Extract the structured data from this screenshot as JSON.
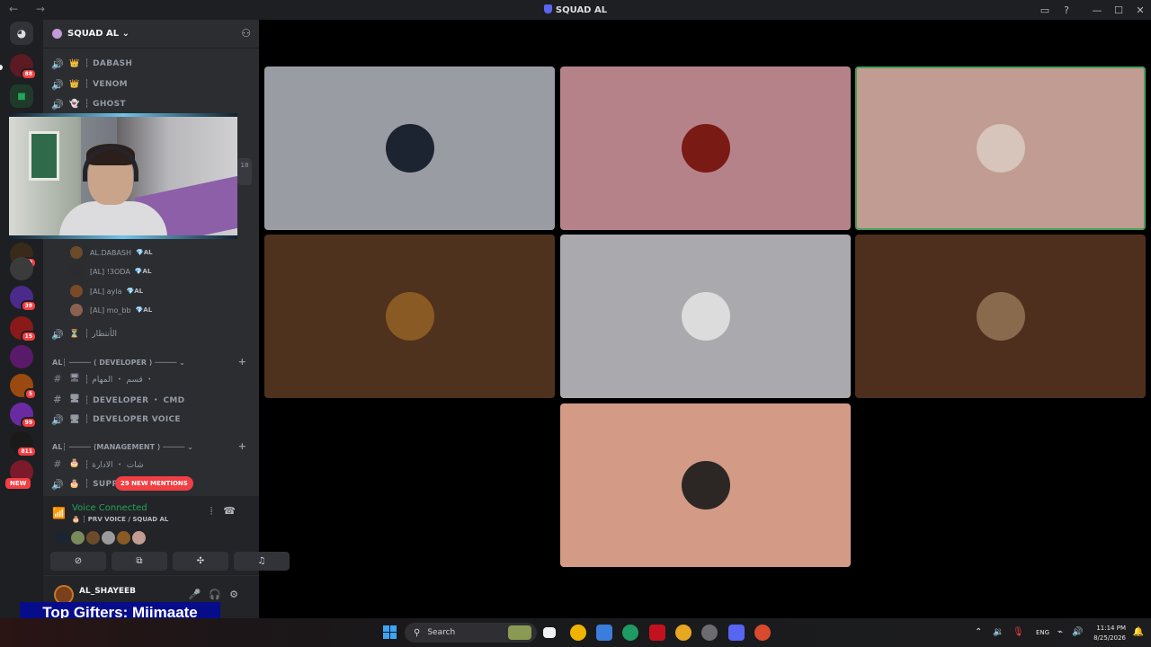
{
  "window": {
    "title": "SQUAD AL",
    "nav": "← →"
  },
  "server": {
    "name": "SQUAD AL ⌄"
  },
  "rail": {
    "badges": [
      "88",
      "49",
      "38",
      "15",
      "5",
      "99",
      "811",
      "NEW"
    ]
  },
  "channels_top": [
    {
      "emoji": "👑",
      "name": "┆ DABASH"
    },
    {
      "emoji": "👑",
      "name": "┆ VENOM"
    },
    {
      "emoji": "👻",
      "name": "┆ GHOST"
    }
  ],
  "side_count": "18",
  "voice_users": [
    {
      "name": "AL.DABASH",
      "tag": "💎AL",
      "color": "#6b4b2a"
    },
    {
      "name": "[AL] !3ODA",
      "tag": "💎AL",
      "color": "#2c2c30"
    },
    {
      "name": "[AL] ayla",
      "tag": "💎AL",
      "color": "#7a4a28"
    },
    {
      "name": "[AL] mo_bb",
      "tag": "💎AL",
      "color": "#8a6050"
    }
  ],
  "channels_mid": {
    "emoji": "⏳",
    "name": "┆ الأنتظار"
  },
  "category_dev": "AL┆ ───── ⟨ DEVELOPER ⟩ ───── ⌄",
  "dev_channels": [
    {
      "emoji": "🖥",
      "name": "┆ قسم ・ المهام ・",
      "type": "#"
    },
    {
      "emoji": "🖥",
      "name": "┆ DEVELOPER ・ CMD",
      "type": "#"
    },
    {
      "emoji": "🖥",
      "name": "┆ DEVELOPER VOICE",
      "type": "voice"
    }
  ],
  "category_mgmt": "AL┆ ───── ⟨MANAGEMENT ⟩ ───── ⌄",
  "mgmt_channels": [
    {
      "emoji": "🎂",
      "name": "┆ شات ・ الادارة",
      "type": "#"
    },
    {
      "emoji": "🎂",
      "name": "┆ SUPP",
      "type": "voice"
    }
  ],
  "mentions": "29 NEW MENTIONS",
  "voice": {
    "status": "Voice Connected",
    "channel": "🎂 ┆ PRV VOICE / SQUAD AL"
  },
  "user": {
    "name": "AL_SHAYEEB"
  },
  "overlay": {
    "gifters": "Top Gifters: Miimaate"
  },
  "tiles": [
    {
      "bg": "#9a9ca4",
      "avatar": "#1b2430",
      "speaking": false
    },
    {
      "bg": "#b5828a",
      "avatar": "#7a1a14",
      "speaking": false
    },
    {
      "bg": "#c09c92",
      "avatar": "#d7c4ba",
      "speaking": true
    },
    {
      "bg": "#4e321d",
      "avatar": "#8a5a24",
      "speaking": false
    },
    {
      "bg": "#a9a9ae",
      "avatar": "#dcdcdc",
      "speaking": false
    },
    {
      "bg": "#4e2f1e",
      "avatar": "#8a6a4c",
      "speaking": false
    },
    {
      "bg": "#d39a86",
      "avatar": "#2c2724",
      "speaking": false
    }
  ],
  "taskbar": {
    "search": "Search",
    "lang": "ENG",
    "time": "11:14 PM",
    "date": "8/25/2026"
  }
}
